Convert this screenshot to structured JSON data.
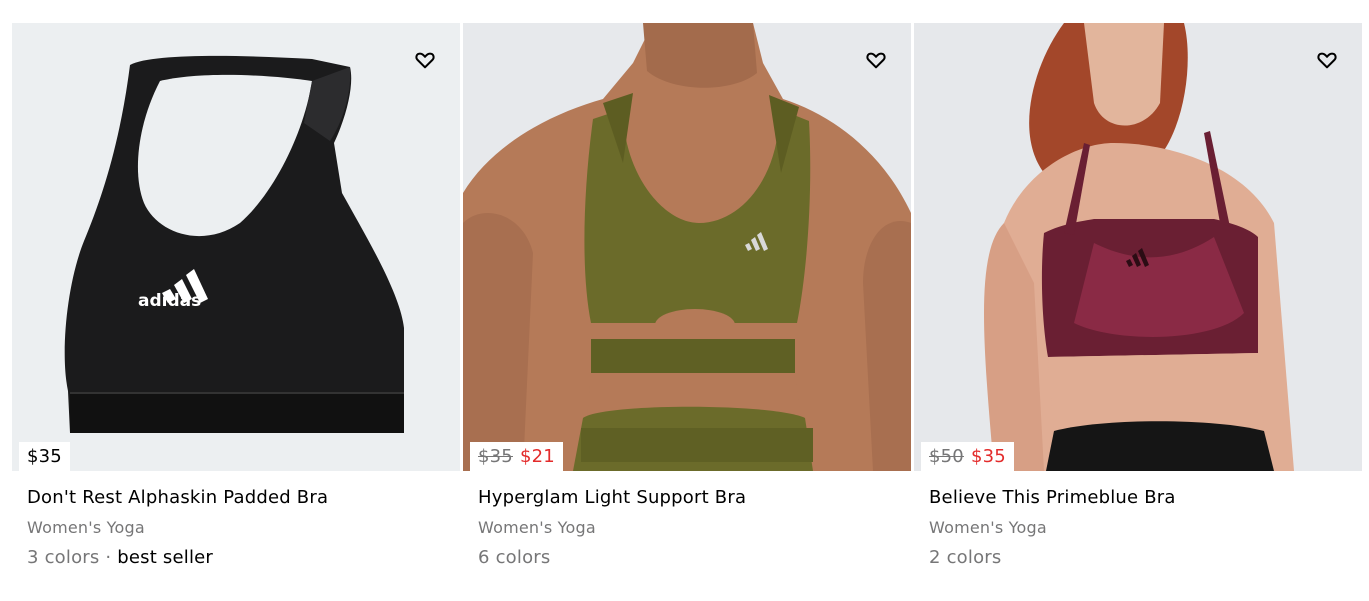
{
  "products": [
    {
      "name": "Don't Rest Alphaskin Padded Bra",
      "category": "Women's Yoga",
      "colors": "3 colors",
      "separator": " · ",
      "badge": "best seller",
      "price_old": "",
      "price_sale": "",
      "price_regular": "$35",
      "image_icon": "black-sports-bra-image",
      "garment_color": "#1b1b1c"
    },
    {
      "name": "Hyperglam Light Support Bra",
      "category": "Women's Yoga",
      "colors": "6 colors",
      "separator": "",
      "badge": "",
      "price_old": "$35",
      "price_sale": "$21",
      "price_regular": "",
      "image_icon": "olive-sports-bra-model-image",
      "garment_color": "#6b6b2a"
    },
    {
      "name": "Believe This Primeblue Bra",
      "category": "Women's Yoga",
      "colors": "2 colors",
      "separator": "",
      "badge": "",
      "price_old": "$50",
      "price_sale": "$35",
      "price_regular": "",
      "image_icon": "maroon-sports-bra-model-image",
      "garment_color": "#6a1f33"
    }
  ],
  "wishlist_icon": "heart-icon",
  "colors": {
    "sale": "#e32b2b",
    "muted": "#767677",
    "image_bg": "#eceff1"
  }
}
